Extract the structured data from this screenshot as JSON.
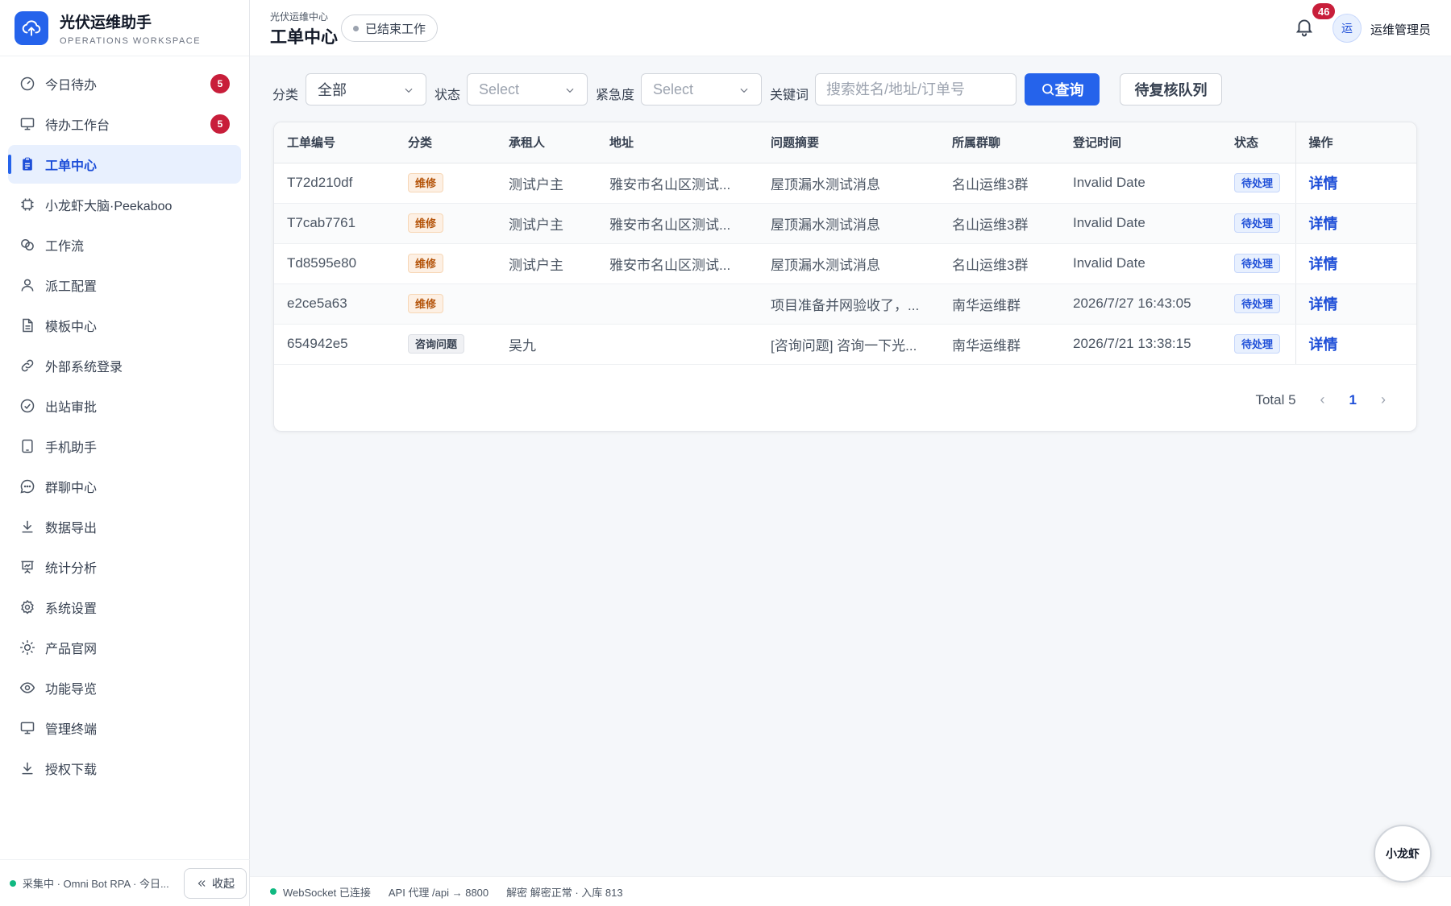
{
  "brand": {
    "title": "光伏运维助手",
    "subtitle": "OPERATIONS WORKSPACE"
  },
  "sidebar": {
    "items": [
      {
        "label": "今日待办",
        "badge": "5"
      },
      {
        "label": "待办工作台",
        "badge": "5"
      },
      {
        "label": "工单中心",
        "active": true
      },
      {
        "label": "小龙虾大脑·Peekaboo"
      },
      {
        "label": "工作流"
      },
      {
        "label": "派工配置"
      },
      {
        "label": "模板中心"
      },
      {
        "label": "外部系统登录"
      },
      {
        "label": "出站审批"
      },
      {
        "label": "手机助手"
      },
      {
        "label": "群聊中心"
      },
      {
        "label": "数据导出"
      },
      {
        "label": "统计分析"
      },
      {
        "label": "系统设置"
      },
      {
        "label": "产品官网"
      },
      {
        "label": "功能导览"
      },
      {
        "label": "管理终端"
      },
      {
        "label": "授权下载"
      }
    ],
    "footer_status": "采集中 · Omni Bot RPA · 今日...",
    "collapse_label": "收起"
  },
  "header": {
    "breadcrumb": "光伏运维中心",
    "title": "工单中心",
    "end_work_label": "已结束工作",
    "notification_count": "46",
    "avatar_text": "运",
    "user_name": "运维管理员"
  },
  "filters": {
    "category_label": "分类",
    "category_value": "全部",
    "status_label": "状态",
    "status_placeholder": "Select",
    "urgency_label": "紧急度",
    "urgency_placeholder": "Select",
    "keyword_label": "关键词",
    "keyword_placeholder": "搜索姓名/地址/订单号",
    "search_button": "查询",
    "review_queue_button": "待复核队列"
  },
  "table": {
    "columns": [
      "工单编号",
      "分类",
      "承租人",
      "地址",
      "问题摘要",
      "所属群聊",
      "登记时间",
      "状态",
      "操作"
    ],
    "rows": [
      {
        "id": "T72d210df",
        "category": "维修",
        "tenant": "测试户主",
        "address": "雅安市名山区测试...",
        "summary": "屋顶漏水测试消息",
        "group": "名山运维3群",
        "time": "Invalid Date",
        "status": "待处理",
        "action": "详情"
      },
      {
        "id": "T7cab7761",
        "category": "维修",
        "tenant": "测试户主",
        "address": "雅安市名山区测试...",
        "summary": "屋顶漏水测试消息",
        "group": "名山运维3群",
        "time": "Invalid Date",
        "status": "待处理",
        "action": "详情"
      },
      {
        "id": "Td8595e80",
        "category": "维修",
        "tenant": "测试户主",
        "address": "雅安市名山区测试...",
        "summary": "屋顶漏水测试消息",
        "group": "名山运维3群",
        "time": "Invalid Date",
        "status": "待处理",
        "action": "详情"
      },
      {
        "id": "e2ce5a63",
        "category": "维修",
        "tenant": "",
        "address": "",
        "summary": "项目准备并网验收了，...",
        "group": "南华运维群",
        "time": "2026/7/27 16:43:05",
        "status": "待处理",
        "action": "详情"
      },
      {
        "id": "654942e5",
        "category": "咨询问题",
        "tenant": "吴九",
        "address": "",
        "summary": "[咨询问题] 咨询一下光...",
        "group": "南华运维群",
        "time": "2026/7/21 13:38:15",
        "status": "待处理",
        "action": "详情"
      }
    ]
  },
  "pagination": {
    "total_label": "Total 5",
    "prev": "‹",
    "current_page": "1",
    "next": "›"
  },
  "statusbar": {
    "websocket": "WebSocket 已连接",
    "api": "API 代理 /api → 8800",
    "decrypt": "解密 解密正常 · 入库 813"
  },
  "fab_label": "小龙虾",
  "colors": {
    "accent": "#2563eb",
    "badge": "#c81e3a",
    "tag_orange": "#b45309",
    "online": "#10b981"
  }
}
